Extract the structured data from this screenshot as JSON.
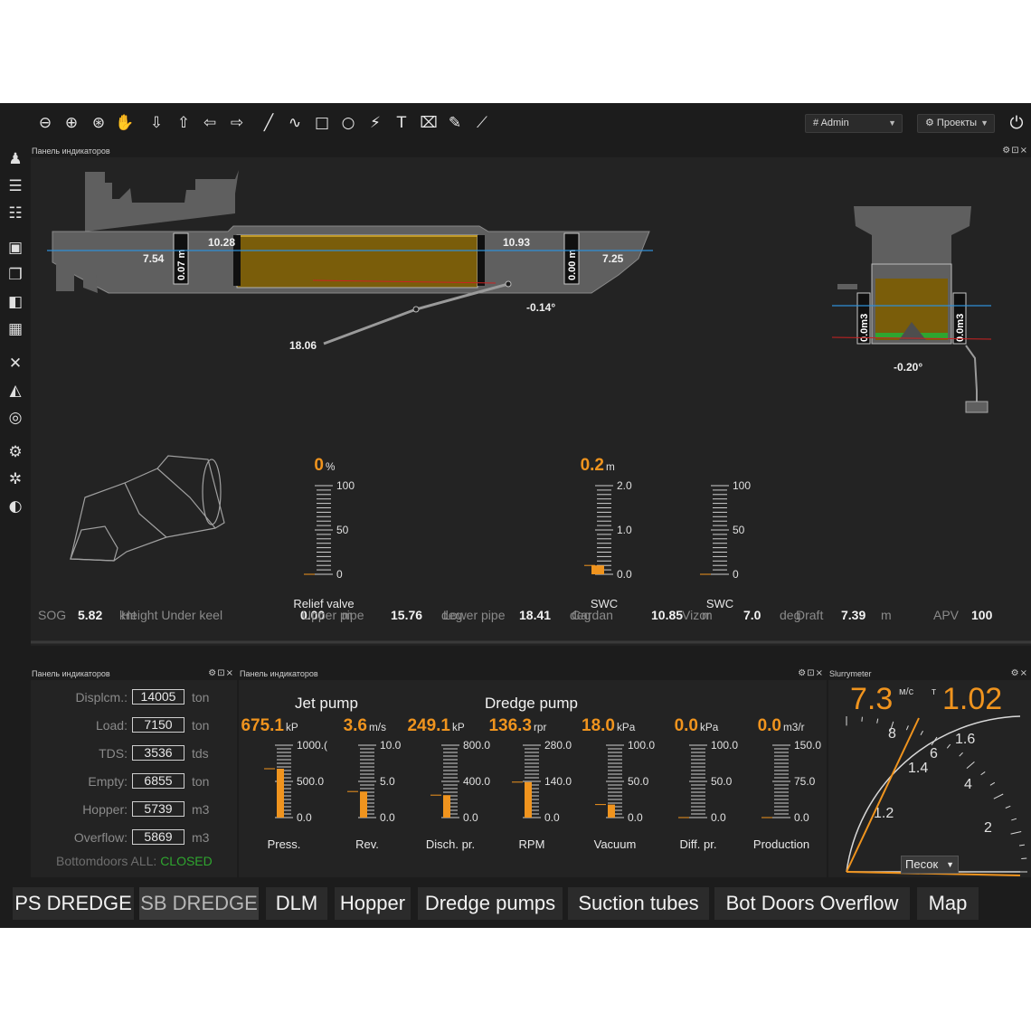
{
  "toolbar": {
    "tools": [
      {
        "name": "zoom-out-icon",
        "glyph": "⊖"
      },
      {
        "name": "zoom-in-icon",
        "glyph": "⊕"
      },
      {
        "name": "target-icon",
        "glyph": "⊛"
      },
      {
        "name": "hand-icon",
        "glyph": "✋"
      },
      {
        "name": "arrow-down-icon",
        "glyph": "⇩"
      },
      {
        "name": "arrow-up-icon",
        "glyph": "⇧"
      },
      {
        "name": "arrow-left-icon",
        "glyph": "⇦"
      },
      {
        "name": "arrow-right-icon",
        "glyph": "⇨"
      },
      {
        "name": "line-icon",
        "glyph": "╱"
      },
      {
        "name": "curve-icon",
        "glyph": "∿"
      },
      {
        "name": "square-icon",
        "glyph": "□"
      },
      {
        "name": "circle-icon",
        "glyph": "○"
      },
      {
        "name": "polyline-icon",
        "glyph": "⚡"
      },
      {
        "name": "text-icon",
        "glyph": "T"
      },
      {
        "name": "xyz-icon",
        "glyph": "⌧"
      },
      {
        "name": "pin-icon",
        "glyph": "✎"
      },
      {
        "name": "ruler-icon",
        "glyph": "⟋"
      }
    ],
    "user": "# Admin",
    "projects": "⚙ Проекты",
    "power_icon": "⏻"
  },
  "sidebar": {
    "icons": [
      {
        "name": "user-icon",
        "glyph": "♟"
      },
      {
        "name": "list-icon",
        "glyph": "☰"
      },
      {
        "name": "layers-icon",
        "glyph": "☷"
      },
      {
        "name": "box-icon",
        "glyph": "▣"
      },
      {
        "name": "copy-icon",
        "glyph": "❐"
      },
      {
        "name": "cube-icon",
        "glyph": "◧"
      },
      {
        "name": "map-icon",
        "glyph": "▦"
      },
      {
        "name": "cross-icon",
        "glyph": "✕"
      },
      {
        "name": "compass-icon",
        "glyph": "◭"
      },
      {
        "name": "dial-icon",
        "glyph": "◎"
      },
      {
        "name": "gear-icon",
        "glyph": "⚙"
      },
      {
        "name": "gear-alt-icon",
        "glyph": "✲"
      },
      {
        "name": "contrast-icon",
        "glyph": "◐"
      }
    ]
  },
  "top_panel": {
    "title": "Панель индикаторов",
    "controls": "⚙⊡×",
    "ship": {
      "draft_aft": "7.54",
      "draft_fwd": "7.25",
      "level_aft_left": "10.28",
      "level_fwd_right": "10.93",
      "bar_aft": "0.07 m",
      "bar_fwd": "0.00 m",
      "trim": "-0.14°",
      "pipe_depth": "18.06"
    },
    "section": {
      "left": "0.0m3",
      "right": "0.0m3",
      "heel": "-0.20°"
    },
    "gauges": [
      {
        "id": "relief",
        "value": "0",
        "unit": "%",
        "ticks": [
          "100",
          "50",
          "0"
        ],
        "label": "Relief valve",
        "fill": 0
      },
      {
        "id": "swc1",
        "value": "0.2",
        "unit": "m",
        "ticks": [
          "2.0",
          "1.0",
          "0.0"
        ],
        "label": "SWC",
        "fill": 0.1
      },
      {
        "id": "swc2",
        "value": "",
        "unit": "",
        "ticks": [
          "100",
          "50",
          "0"
        ],
        "label": "SWC",
        "fill": 0
      }
    ],
    "status_line": [
      {
        "label": "SOG",
        "value": "5.82",
        "unit": "knt"
      },
      {
        "label": "Height Under keel",
        "value": "0.00",
        "unit": "m"
      },
      {
        "label": "Upper pipe",
        "value": "15.76",
        "unit": "deg"
      },
      {
        "label": "Lower pipe",
        "value": "18.41",
        "unit": "deg"
      },
      {
        "label": "Cardan",
        "value": "10.85",
        "unit": "m"
      },
      {
        "label": "Vizor",
        "value": "7.0",
        "unit": "deg"
      },
      {
        "label": "Draft",
        "value": "7.39",
        "unit": "m"
      },
      {
        "label": "APV",
        "value": "100",
        "unit": ""
      }
    ]
  },
  "stats_panel": {
    "title": "Панель индикаторов",
    "controls": "⚙⊡×",
    "rows": [
      {
        "label": "Displcm.:",
        "value": "14005",
        "unit": "ton"
      },
      {
        "label": "Load:",
        "value": "7150",
        "unit": "ton"
      },
      {
        "label": "TDS:",
        "value": "3536",
        "unit": "tds"
      },
      {
        "label": "Empty:",
        "value": "6855",
        "unit": "ton"
      },
      {
        "label": "Hopper:",
        "value": "5739",
        "unit": "m3"
      },
      {
        "label": "Overflow:",
        "value": "5869",
        "unit": "m3"
      }
    ],
    "bottomdoors_label": "Bottomdoors ALL:",
    "bottomdoors_value": "CLOSED"
  },
  "pumps_panel": {
    "title": "Панель индикаторов",
    "controls": "⚙⊡×",
    "jet_title": "Jet pump",
    "dredge_title": "Dredge pump",
    "gauges": [
      {
        "value": "675.1",
        "unit": "kP",
        "ticks": [
          "1000.(",
          "500.0",
          "0.0"
        ],
        "label": "Press.",
        "fill": 0.675
      },
      {
        "value": "3.6",
        "unit": "m/s",
        "ticks": [
          "10.0",
          "5.0",
          "0.0"
        ],
        "label": "Rev.",
        "fill": 0.36
      },
      {
        "value": "249.1",
        "unit": "kP",
        "ticks": [
          "800.0",
          "400.0",
          "0.0"
        ],
        "label": "Disch. pr.",
        "fill": 0.31
      },
      {
        "value": "136.3",
        "unit": "rpr",
        "ticks": [
          "280.0",
          "140.0",
          "0.0"
        ],
        "label": "RPM",
        "fill": 0.49
      },
      {
        "value": "18.0",
        "unit": "kPa",
        "ticks": [
          "100.0",
          "50.0",
          "0.0"
        ],
        "label": "Vacuum",
        "fill": 0.18
      },
      {
        "value": "0.0",
        "unit": "kPa",
        "ticks": [
          "100.0",
          "50.0",
          "0.0"
        ],
        "label": "Diff. pr.",
        "fill": 0
      },
      {
        "value": "0.0",
        "unit": "m3/r",
        "ticks": [
          "150.0",
          "75.0",
          "0.0"
        ],
        "label": "Production",
        "fill": 0
      }
    ]
  },
  "slurry_panel": {
    "title": "Slurrymeter",
    "controls": "⚙×",
    "velocity": "7.3",
    "velocity_unit": "м/с",
    "density_unit": "т",
    "density": "1.02",
    "scale_velocity": [
      "8",
      "6",
      "4",
      "2"
    ],
    "scale_density": [
      "1.6",
      "1.4",
      "1.2"
    ],
    "material": "Песок"
  },
  "tabs": [
    {
      "label": "PS DREDGE",
      "dim": false
    },
    {
      "label": "SB DREDGE",
      "dim": true
    },
    {
      "label": "DLM",
      "dim": false
    },
    {
      "label": "Hopper",
      "dim": false
    },
    {
      "label": "Dredge pumps",
      "dim": false
    },
    {
      "label": "Suction tubes",
      "dim": false
    },
    {
      "label": "Bot Doors Overflow",
      "dim": false
    },
    {
      "label": "Map",
      "dim": false
    }
  ],
  "colors": {
    "accent": "#f0941e",
    "cargo": "#7a5d0a",
    "waterline": "#2e8fd6",
    "ship": "#5f5f5f",
    "closed": "#2fa52f",
    "panel": "#232323"
  }
}
